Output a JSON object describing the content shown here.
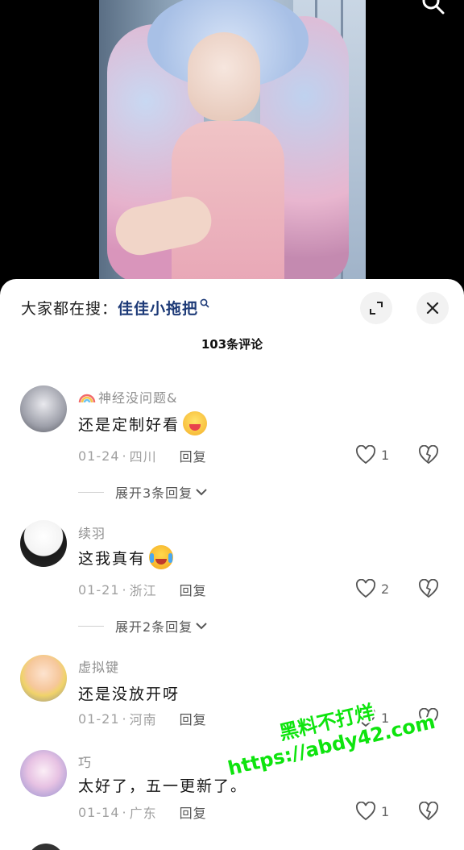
{
  "search": {
    "prefix": "大家都在搜：",
    "query": "佳佳小拖把"
  },
  "comments_header": {
    "count_label": "103条评论"
  },
  "comments": [
    {
      "username": "神经没问题&",
      "text": "还是定制好看",
      "date": "01-24",
      "location": "四川",
      "reply_label": "回复",
      "likes": "1",
      "expand_label": "展开3条回复",
      "badge_icon": "rainbow-icon",
      "emoji_icon": "yummy-face-emoji"
    },
    {
      "username": "续羽",
      "text": "这我真有",
      "date": "01-21",
      "location": "浙江",
      "reply_label": "回复",
      "likes": "2",
      "expand_label": "展开2条回复",
      "emoji_icon": "crying-laugh-emoji"
    },
    {
      "username": "虚拟键",
      "text": "还是没放开呀",
      "date": "01-21",
      "location": "河南",
      "reply_label": "回复",
      "likes": "1"
    },
    {
      "username": "巧",
      "text": "太好了，五一更新了。",
      "date": "01-14",
      "location": "广东",
      "reply_label": "回复",
      "likes": "1"
    }
  ],
  "watermark": {
    "line1": "黑料不打烊",
    "line2": "https://abdy42.com"
  },
  "colors": {
    "search_query": "#1d3a77",
    "watermark": "#0ee40e"
  }
}
